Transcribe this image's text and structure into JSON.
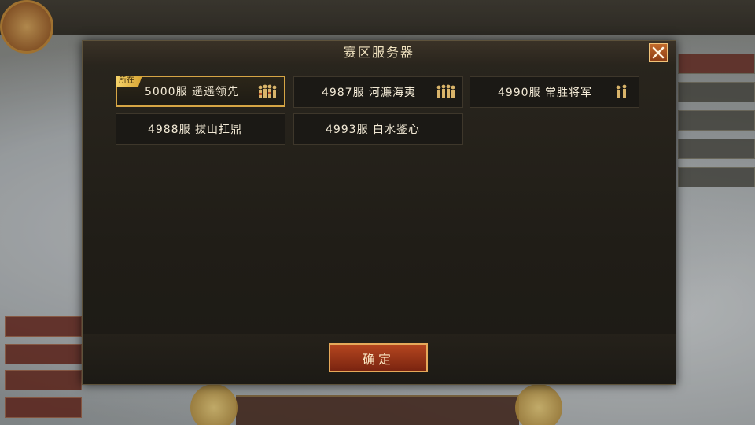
{
  "dialog": {
    "title": "赛区服务器",
    "current_tag": "所在",
    "confirm_label": "确定"
  },
  "servers": [
    {
      "label": "5000服 遥遥领先",
      "current": true,
      "icon": "soldiers-icon"
    },
    {
      "label": "4987服 河濂海夷",
      "current": false,
      "icon": "soldiers-icon"
    },
    {
      "label": "4990服 常胜将军",
      "current": false,
      "icon": "soldiers-icon"
    },
    {
      "label": "4988服 拔山扛鼎",
      "current": false,
      "icon": ""
    },
    {
      "label": "4993服 白水鉴心",
      "current": false,
      "icon": ""
    }
  ],
  "colors": {
    "accent_gold": "#d6a545",
    "button_red": "#b5461f",
    "text_light": "#f3ead6"
  }
}
